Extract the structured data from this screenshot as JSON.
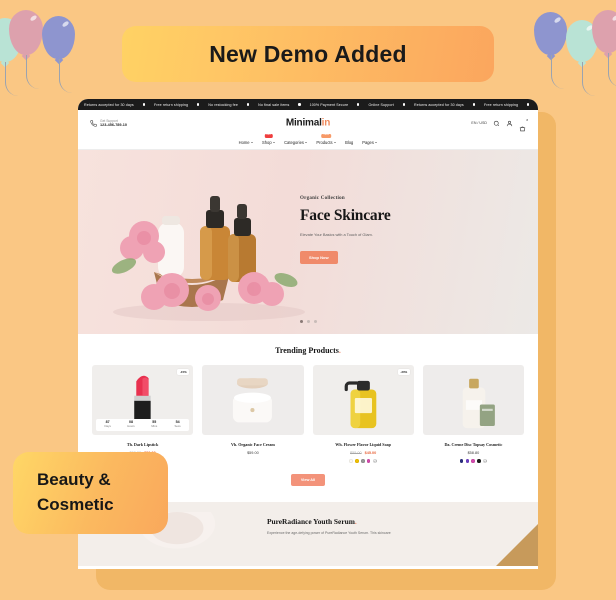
{
  "promo": {
    "banner_text": "New Demo Added",
    "category_line1": "Beauty &",
    "category_line2": "Cosmetic"
  },
  "colors": {
    "page_background": "#fac784",
    "banner_gradient_start": "#ffd264",
    "banner_gradient_end": "#fba65e",
    "accent": "#f08a6a",
    "badge_hot": "#ef3e3e",
    "badge_new": "#f79a68",
    "sale_price": "#e8663c"
  },
  "balloons": [
    {
      "name": "balloon-mint",
      "color": "#b9e3d5"
    },
    {
      "name": "balloon-pink",
      "color": "#dda1ad"
    },
    {
      "name": "balloon-blue",
      "color": "#8e95cf"
    },
    {
      "name": "balloon-blue-right",
      "color": "#8e95cf"
    },
    {
      "name": "balloon-mint-right",
      "color": "#b9e3d5"
    },
    {
      "name": "balloon-pink-right",
      "color": "#dda1ad"
    }
  ],
  "site": {
    "ticker": [
      "Returns accepted for 30 days",
      "Free return shipping",
      "No restocking fee",
      "No final sale items",
      "100% Payment Secure",
      "Online Support",
      "Returns accepted for 30 days",
      "Free return shipping",
      "No restocking fee",
      "No final sale items"
    ],
    "header": {
      "support_label": "Get Support",
      "support_phone": "123-456-789-10",
      "brand_main": "Minimal",
      "brand_accent": "in",
      "currency": "EN / USD",
      "icons": [
        "phone-icon",
        "search-icon",
        "account-icon",
        "cart-icon"
      ],
      "cart_count": "0"
    },
    "nav": [
      {
        "label": "Home",
        "badge": "",
        "badge_type": ""
      },
      {
        "label": "Shop",
        "badge": "Hot",
        "badge_type": "hot"
      },
      {
        "label": "Categories",
        "badge": "",
        "badge_type": ""
      },
      {
        "label": "Products",
        "badge": "New",
        "badge_type": "new"
      },
      {
        "label": "Blog",
        "badge": "",
        "badge_type": ""
      },
      {
        "label": "Pages",
        "badge": "",
        "badge_type": ""
      }
    ],
    "hero": {
      "eyebrow": "Organic Collection",
      "title": "Face Skincare",
      "subtitle": "Elevate Your Basics with a Touch of Glam.",
      "cta": "Shop Now",
      "slide_dots": 3,
      "active_dot": 1
    },
    "trending": {
      "title": "Trending Products",
      "view_all": "View All",
      "products": [
        {
          "name": "Th. Dark Lipstick",
          "price_old": "$60.00",
          "price_new": "$50.00",
          "discount": "-15%",
          "has_countdown": true,
          "countdown": [
            {
              "value": "87",
              "label": "Days"
            },
            {
              "value": "08",
              "label": "Hours"
            },
            {
              "value": "55",
              "label": "Mins"
            },
            {
              "value": "54",
              "label": "Secs"
            }
          ],
          "swatches": [
            "#e03a3a",
            "#2fae55",
            "#2f5fd1",
            "#f2d000"
          ],
          "more_swatches": "+2"
        },
        {
          "name": "Vh. Organic Face Cream",
          "price_single": "$59.00",
          "discount": "",
          "has_countdown": false,
          "swatches": [],
          "more_swatches": ""
        },
        {
          "name": "Wh. Flower Flavor Liquid Soap",
          "price_old": "$55.00",
          "price_new": "$45.00",
          "discount": "-30%",
          "has_countdown": false,
          "swatches": [
            "#fdfbf5",
            "#f2c200",
            "#9a9a9a",
            "#d74bb0"
          ],
          "more_swatches": "+3"
        },
        {
          "name": "Da. Creme Disc Topsay Cosmetic",
          "price_single": "$58.80",
          "discount": "",
          "has_countdown": false,
          "swatches": [
            "#2b2f80",
            "#6e3fc7",
            "#d74bb0",
            "#1c1c1c"
          ],
          "more_swatches": "+2"
        }
      ]
    },
    "feature": {
      "title": "PureRadiance Youth Serum",
      "description": "Experience the age-defying power of PureRadiance Youth Serum. This skincare"
    }
  }
}
